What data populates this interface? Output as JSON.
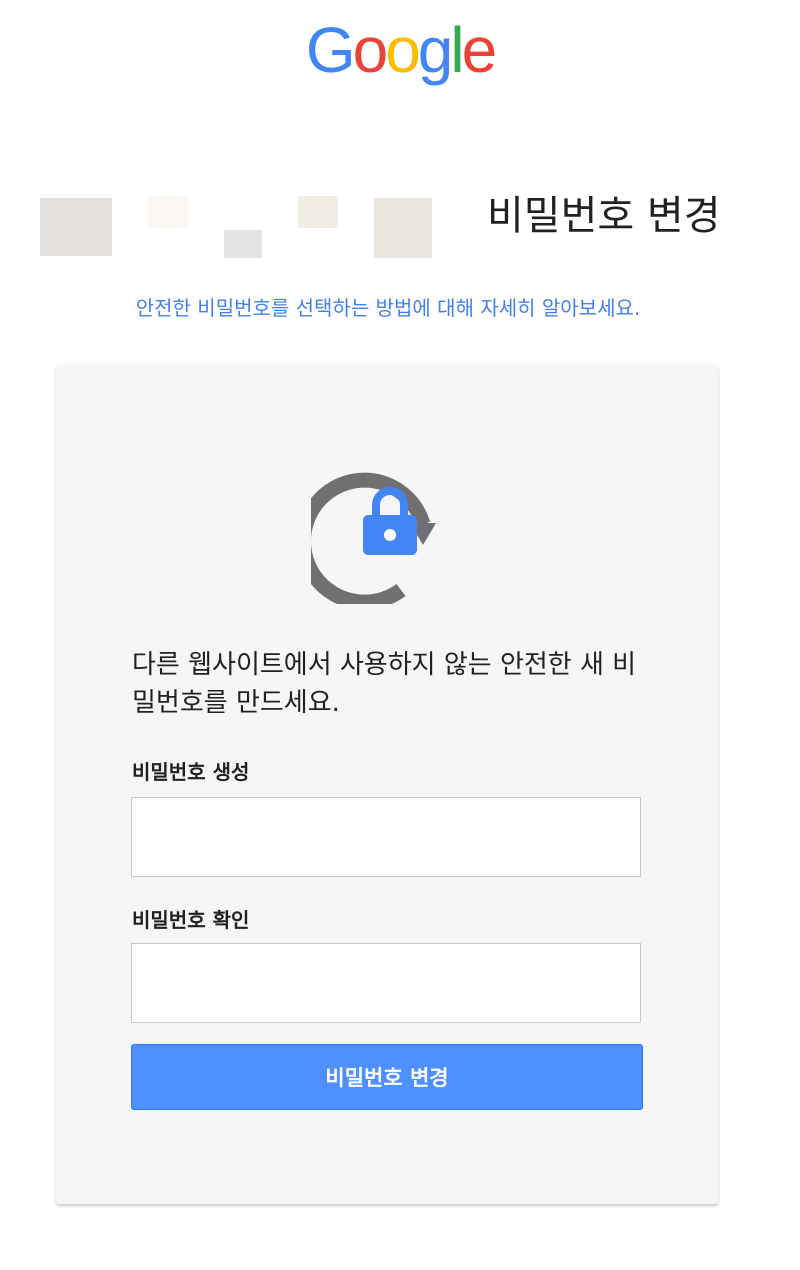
{
  "header": {
    "logo_letters": [
      "G",
      "o",
      "o",
      "g",
      "l",
      "e"
    ],
    "logo_colors": [
      "#4285f4",
      "#ea4335",
      "#fbbc05",
      "#4285f4",
      "#34a853",
      "#ea4335"
    ]
  },
  "title": "비밀번호 변경",
  "help_link": "안전한 비밀번호를 선택하는 방법에 대해 자세히 알아보세요.",
  "card": {
    "illustration_icon": "lock-rotate-icon",
    "description": "다른 웹사이트에서 사용하지 않는 안전한 새 비밀번호를 만드세요.",
    "new_password": {
      "label": "비밀번호 생성",
      "value": "",
      "placeholder": ""
    },
    "confirm_password": {
      "label": "비밀번호 확인",
      "value": "",
      "placeholder": ""
    },
    "submit_label": "비밀번호 변경"
  },
  "colors": {
    "accent": "#4d90fe",
    "link": "#427fed",
    "lock": "#4285f4",
    "arrow": "#707070"
  }
}
